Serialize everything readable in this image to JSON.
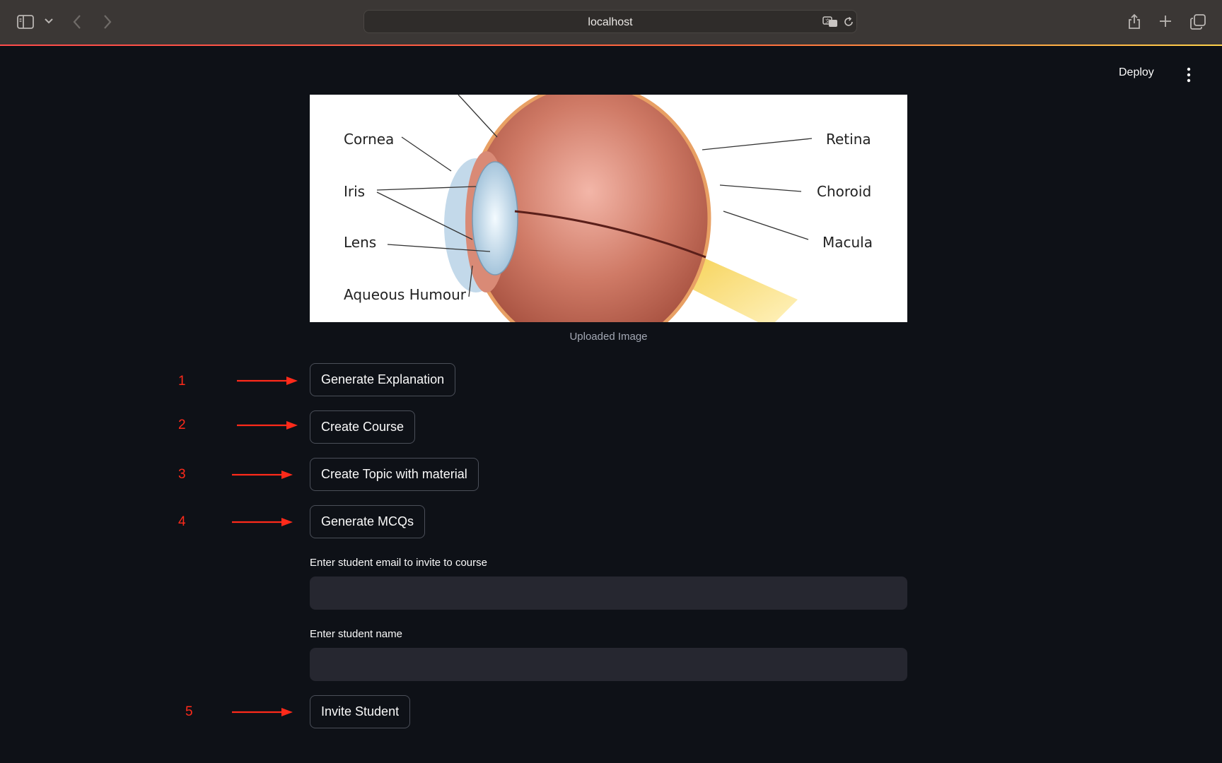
{
  "browser": {
    "address": "localhost"
  },
  "app": {
    "deploy_label": "Deploy"
  },
  "image": {
    "caption": "Uploaded Image",
    "labels": [
      "Cornea",
      "Iris",
      "Lens",
      "Aqueous Humour",
      "Retina",
      "Choroid",
      "Macula"
    ]
  },
  "annotations": [
    "1",
    "2",
    "3",
    "4",
    "5"
  ],
  "buttons": {
    "generate_explanation": "Generate Explanation",
    "create_course": "Create Course",
    "create_topic": "Create Topic with material",
    "generate_mcqs": "Generate MCQs",
    "invite_student": "Invite Student"
  },
  "form": {
    "email_label": "Enter student email to invite to course",
    "email_value": "",
    "name_label": "Enter student name",
    "name_value": ""
  },
  "colors": {
    "background": "#0e1117",
    "input_bg": "#262730",
    "annotation_red": "#ff2a1a",
    "button_border": "#4b4f59"
  }
}
